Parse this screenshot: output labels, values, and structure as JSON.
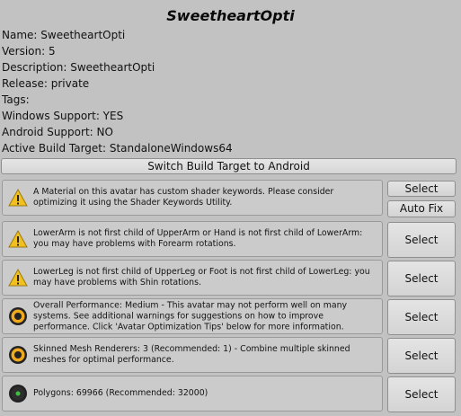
{
  "header": {
    "title": "SweetheartOpti"
  },
  "info": {
    "name": "Name: SweetheartOpti",
    "version": "Version: 5",
    "description": "Description: SweetheartOpti",
    "release": "Release: private",
    "tags": "Tags:",
    "windows_support": "Windows Support: YES",
    "android_support": "Android Support: NO",
    "active_build_target": "Active Build Target: StandaloneWindows64"
  },
  "switch_button": {
    "label": "Switch Build Target to Android"
  },
  "warnings": [
    {
      "icon": "warning-triangle-icon",
      "text": "A Material on this avatar has custom shader keywords. Please consider optimizing it using the Shader Keywords Utility.",
      "buttons": [
        "Select",
        "Auto Fix"
      ]
    },
    {
      "icon": "warning-triangle-icon",
      "text": "LowerArm is not first child of UpperArm or Hand is not first child of LowerArm: you may have problems with Forearm rotations.",
      "buttons": [
        "Select"
      ]
    },
    {
      "icon": "warning-triangle-icon",
      "text": "LowerLeg is not first child of UpperLeg or Foot is not first child of LowerLeg: you may have problems with Shin rotations.",
      "buttons": [
        "Select"
      ]
    },
    {
      "icon": "performance-medium-icon",
      "text": "Overall Performance: Medium - This avatar may not perform well on many systems. See additional warnings for suggestions on how to improve performance. Click 'Avatar Optimization Tips' below for more information.",
      "buttons": [
        "Select"
      ]
    },
    {
      "icon": "performance-medium-icon",
      "text": "Skinned Mesh Renderers: 3 (Recommended: 1) - Combine multiple skinned meshes for optimal performance.",
      "buttons": [
        "Select"
      ]
    },
    {
      "icon": "performance-good-icon",
      "text": "Polygons: 69966 (Recommended: 32000)",
      "buttons": [
        "Select"
      ]
    }
  ],
  "colors": {
    "warning_yellow": "#f2c01e",
    "medium_orange": "#f0a81c",
    "good_green": "#3fbf3f"
  }
}
